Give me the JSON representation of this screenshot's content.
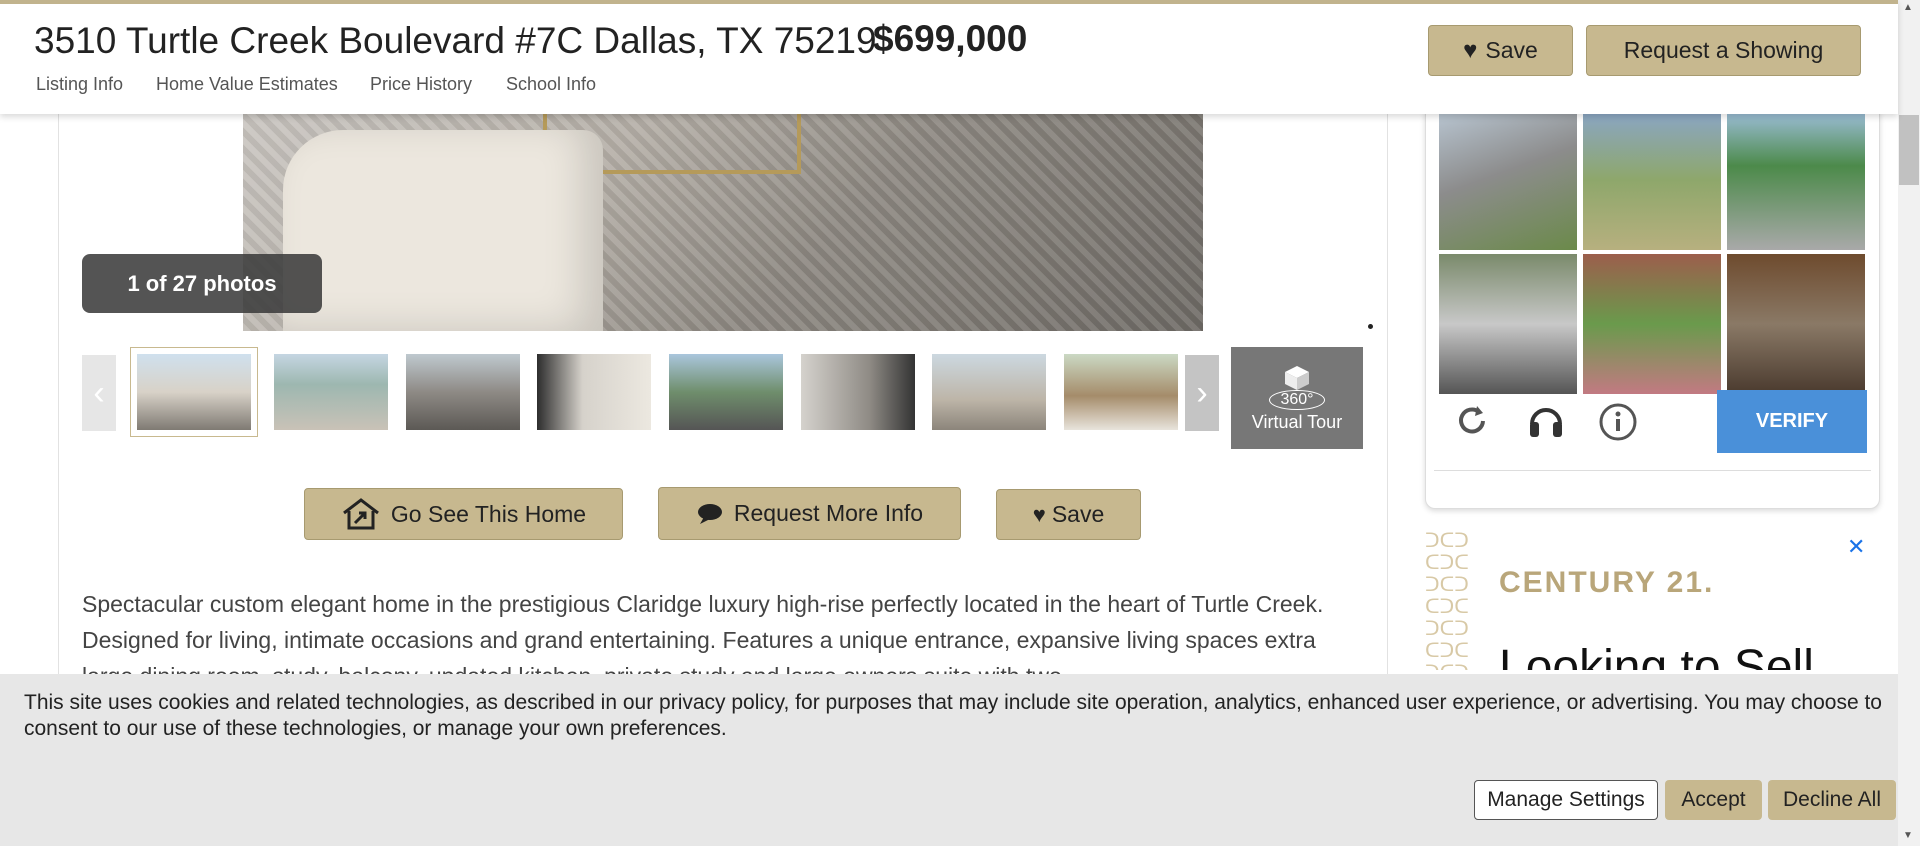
{
  "header": {
    "address": "3510 Turtle Creek Boulevard #7C Dallas, TX 75219",
    "price": "$699,000",
    "nav": [
      "Listing Info",
      "Home Value Estimates",
      "Price History",
      "School Info"
    ],
    "save_label": "Save",
    "request_showing_label": "Request a Showing"
  },
  "gallery": {
    "photo_count": "1 of 27 photos",
    "virtual_tour": {
      "top": "360°",
      "bottom": "Virtual Tour"
    }
  },
  "actions": {
    "go_see": "Go See This Home",
    "request_info": "Request More Info",
    "save": "Save"
  },
  "description": "Spectacular custom elegant home in the prestigious Claridge luxury high-rise perfectly located in the heart of Turtle Creek. Designed for living, intimate occasions and grand entertaining. Features a unique entrance, expansive living spaces extra large dining room, study, balcony, updated kitchen, private study and large owners suite with two",
  "captcha": {
    "verify_label": "VERIFY",
    "icons": [
      "reload-icon",
      "headphones-icon",
      "info-icon"
    ]
  },
  "ad": {
    "brand": "CENTURY 21.",
    "headline": "Looking to Sell",
    "close": "✕"
  },
  "cookie_banner": {
    "text": "This site uses cookies and related technologies, as described in our privacy policy, for purposes that may include site operation, analytics, enhanced user experience, or advertising. You may choose to consent to our use of these technologies, or manage your own preferences.",
    "manage_label": "Manage Settings",
    "accept_label": "Accept",
    "decline_label": "Decline All"
  },
  "colors": {
    "gold": "#c7b88f",
    "verify_blue": "#4a90d9",
    "banner_bg": "#e7e7e7"
  }
}
